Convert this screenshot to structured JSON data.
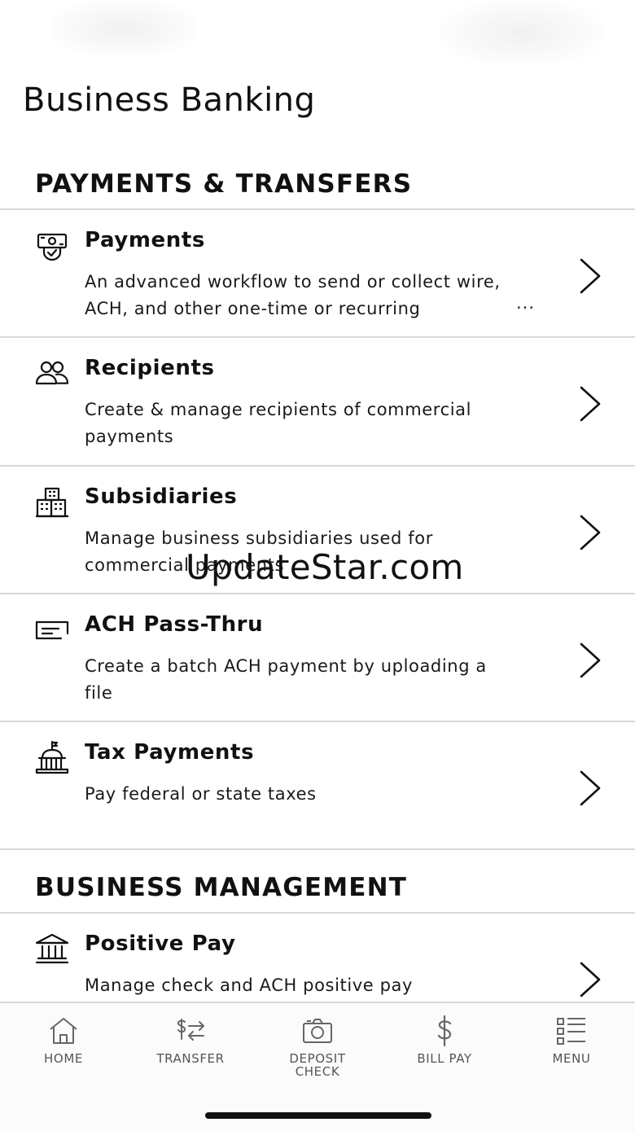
{
  "page": {
    "title": "Business Banking"
  },
  "sections": [
    {
      "header": "PAYMENTS & TRANSFERS",
      "items": [
        {
          "icon": "payments-icon",
          "title": "Payments",
          "description": "An advanced workflow to send or collect wire, ACH, and other one-time or recurring",
          "ellipsis": "..."
        },
        {
          "icon": "recipients-icon",
          "title": "Recipients",
          "description": "Create & manage recipients of commercial payments"
        },
        {
          "icon": "subsidiaries-icon",
          "title": "Subsidiaries",
          "description": "Manage business subsidiaries used for commercial payments"
        },
        {
          "icon": "ach-file-icon",
          "title": "ACH Pass-Thru",
          "description": "Create a batch ACH payment by uploading a file"
        },
        {
          "icon": "capitol-building-icon",
          "title": "Tax Payments",
          "description": "Pay federal or state taxes"
        }
      ]
    },
    {
      "header": "BUSINESS MANAGEMENT",
      "items": [
        {
          "icon": "bank-building-icon",
          "title": "Positive Pay",
          "description": "Manage check and ACH positive pay"
        }
      ]
    }
  ],
  "watermark": "UpdateStar.com",
  "tabbar": [
    {
      "icon": "home-icon",
      "label": "HOME"
    },
    {
      "icon": "transfer-icon",
      "label": "TRANSFER"
    },
    {
      "icon": "camera-icon",
      "label": "DEPOSIT\nCHECK"
    },
    {
      "icon": "dollar-icon",
      "label": "BILL PAY"
    },
    {
      "icon": "menu-list-icon",
      "label": "MENU"
    }
  ]
}
